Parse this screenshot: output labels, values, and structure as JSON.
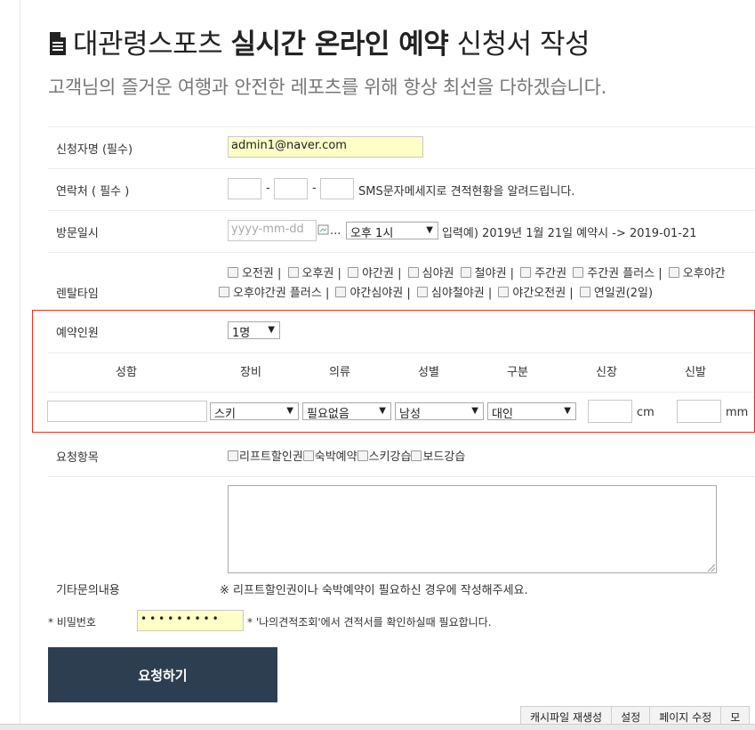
{
  "header": {
    "title_prefix": "대관령스포츠 ",
    "title_bold": "실시간 온라인 예약",
    "title_suffix": " 신청서 작성",
    "subtitle": "고객님의 즐거운 여행과 안전한 레포츠를 위해 항상 최선을 다하겠습니다."
  },
  "form": {
    "applicant_label": "신청자명 (필수)",
    "applicant_value": "admin1@naver.com",
    "phone_label": "연락처 ( 필수 )",
    "phone_note": "SMS문자메세지로 견적현황을 알려드립니다.",
    "phone_dash": "-",
    "visit_label": "방문일시",
    "visit_date_placeholder": "yyyy-mm-dd",
    "visit_broken_img_text": "...",
    "visit_time_value": "오후 1시",
    "visit_note": "입력예) 2019년 1월 21일 예약시 -> 2019-01-21",
    "rental_label": "렌탈타임",
    "rental_options_row1": [
      "오전권 |",
      "오후권 |",
      "야간권 |",
      "심야권",
      "철야권 |",
      "주간권",
      "주간권 플러스 |",
      "오후야간"
    ],
    "rental_options_row2": [
      "오후야간권 플러스 |",
      "야간심야권 |",
      "심야철야권 |",
      "야간오전권 |",
      "연일권(2일)"
    ],
    "people_label": "예약인원",
    "people_value": "1명",
    "columns": [
      "성함",
      "장비",
      "의류",
      "성별",
      "구분",
      "신장",
      "신발"
    ],
    "row": {
      "name_value": "",
      "equipment": "스키",
      "clothing": "필요없음",
      "gender": "남성",
      "category": "대인",
      "height_unit": "cm",
      "shoe_unit": "mm"
    },
    "request_label": "요청항목",
    "request_options": [
      "리프트할인권",
      "숙박예약",
      "스키강습",
      "보드강습"
    ],
    "inquiry_label": "기타문의내용",
    "inquiry_note": "※ 리프트할인권이나 숙박예약이 필요하신 경우에 작성해주세요.",
    "password_label": "* 비밀번호",
    "password_mask": "•••••••••",
    "password_note": "* '나의견적조회'에서 견적서를 확인하실때 필요합니다.",
    "submit_label": "요청하기"
  },
  "admin_tabs": [
    "캐시파일 재생성",
    "설정",
    "페이지 수정",
    "모"
  ],
  "colors": {
    "submit_bg": "#2d3e50",
    "highlight_border": "#d9342b",
    "autofill_bg": "#fdffc6"
  }
}
